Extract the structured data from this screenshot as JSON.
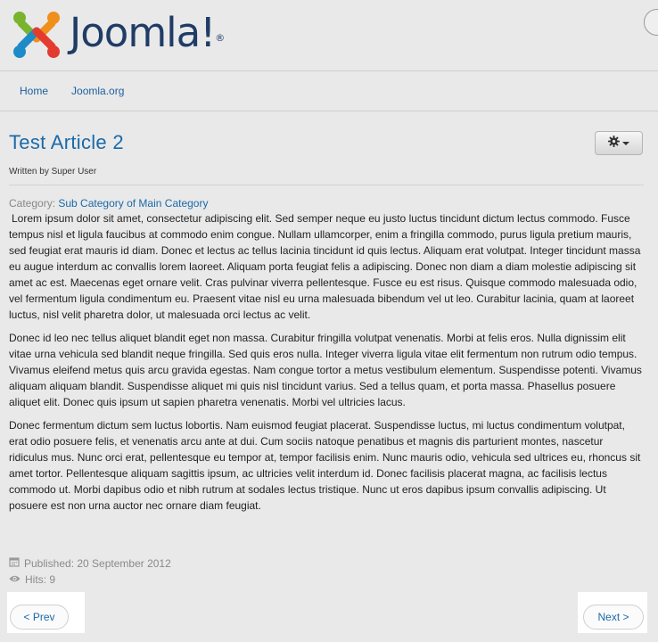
{
  "header": {
    "brand_name": "Joomla!",
    "registered_mark": "®",
    "logo_icon": "joomla-logo-icon"
  },
  "nav": {
    "items": [
      {
        "label": "Home"
      },
      {
        "label": "Joomla.org"
      }
    ]
  },
  "article": {
    "title": "Test Article 2",
    "author": "Written by Super User",
    "category_label": "Category:",
    "category_link": "Sub Category of Main Category",
    "paragraphs": [
      "Lorem ipsum dolor sit amet, consectetur adipiscing elit. Sed semper neque eu justo luctus tincidunt dictum lectus commodo. Fusce tempus nisl et ligula faucibus at commodo enim congue. Nullam ullamcorper, enim a fringilla commodo, purus ligula pretium mauris, sed feugiat erat mauris id diam. Donec et lectus ac tellus lacinia tincidunt id quis lectus. Aliquam erat volutpat. Integer tincidunt massa eu augue interdum ac convallis lorem laoreet. Aliquam porta feugiat felis a adipiscing. Donec non diam a diam molestie adipiscing sit amet ac est. Maecenas eget ornare velit. Cras pulvinar viverra pellentesque. Fusce eu est risus. Quisque commodo malesuada odio, vel fermentum ligula condimentum eu. Praesent vitae nisl eu urna malesuada bibendum vel ut leo. Curabitur lacinia, quam at laoreet luctus, nisl velit pharetra dolor, ut malesuada orci lectus ac velit.",
      "Donec id leo nec tellus aliquet blandit eget non massa. Curabitur fringilla volutpat venenatis. Morbi at felis eros. Nulla dignissim elit vitae urna vehicula sed blandit neque fringilla. Sed quis eros nulla. Integer viverra ligula vitae elit fermentum non rutrum odio tempus. Vivamus eleifend metus quis arcu gravida egestas. Nam congue tortor a metus vestibulum elementum. Suspendisse potenti. Vivamus aliquam aliquam blandit. Suspendisse aliquet mi quis nisl tincidunt varius. Sed a tellus quam, et porta massa. Phasellus posuere aliquet elit. Donec quis ipsum ut sapien pharetra venenatis. Morbi vel ultricies lacus.",
      "Donec fermentum dictum sem luctus lobortis. Nam euismod feugiat placerat. Suspendisse luctus, mi luctus condimentum volutpat, erat odio posuere felis, et venenatis arcu ante at dui. Cum sociis natoque penatibus et magnis dis parturient montes, nascetur ridiculus mus. Nunc orci erat, pellentesque eu tempor at, tempor facilisis enim. Nunc mauris odio, vehicula sed ultrices eu, rhoncus sit amet tortor. Pellentesque aliquam sagittis ipsum, ac ultricies velit interdum id. Donec facilisis placerat magna, ac facilisis lectus commodo ut. Morbi dapibus odio et nibh rutrum at sodales lectus tristique. Nunc ut eros dapibus ipsum convallis adipiscing. Ut posuere est non urna auctor nec ornare diam feugiat."
    ],
    "published": "Published: 20 September 2012",
    "hits": "Hits: 9",
    "tools_icon": "gear-icon"
  },
  "pager": {
    "prev_label": "< Prev",
    "next_label": "Next >"
  },
  "colors": {
    "link": "#1a6aa9",
    "brand_text": "#1f3c66",
    "background": "#e9e9e9"
  }
}
